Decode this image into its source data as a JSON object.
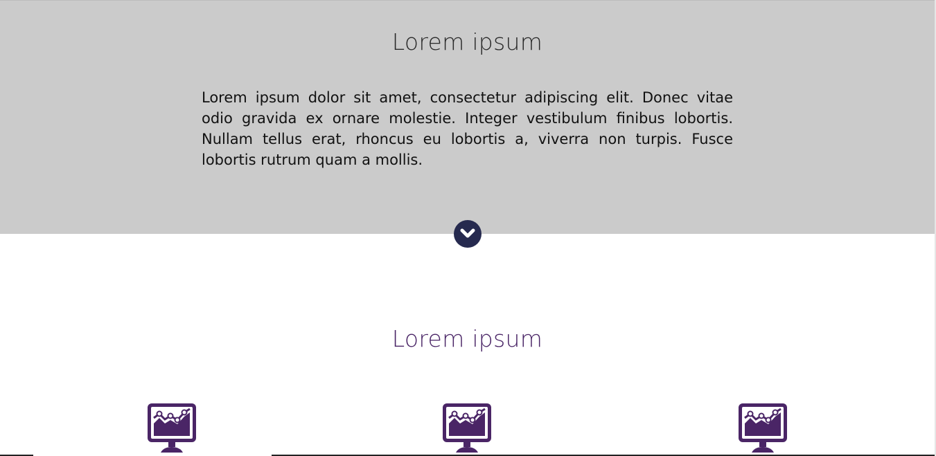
{
  "hero": {
    "title": "Lorem ipsum",
    "text": "Lorem ipsum dolor sit amet, consectetur adipiscing elit. Donec vitae odio gravida ex ornare molestie. Integer vestibulum finibus lobortis. Nullam tellus erat, rhoncus eu lobortis a, viverra non turpis. Fusce lobortis rutrum quam a mollis.",
    "background_color": "#cbcbcb",
    "scroll_icon": "chevron-down-icon",
    "scroll_icon_color": "#262a4f"
  },
  "features": {
    "title": "Lorem ipsum",
    "title_color": "#4a2566",
    "icon": "monitor-chart-icon",
    "icon_color": "#4a2566"
  }
}
